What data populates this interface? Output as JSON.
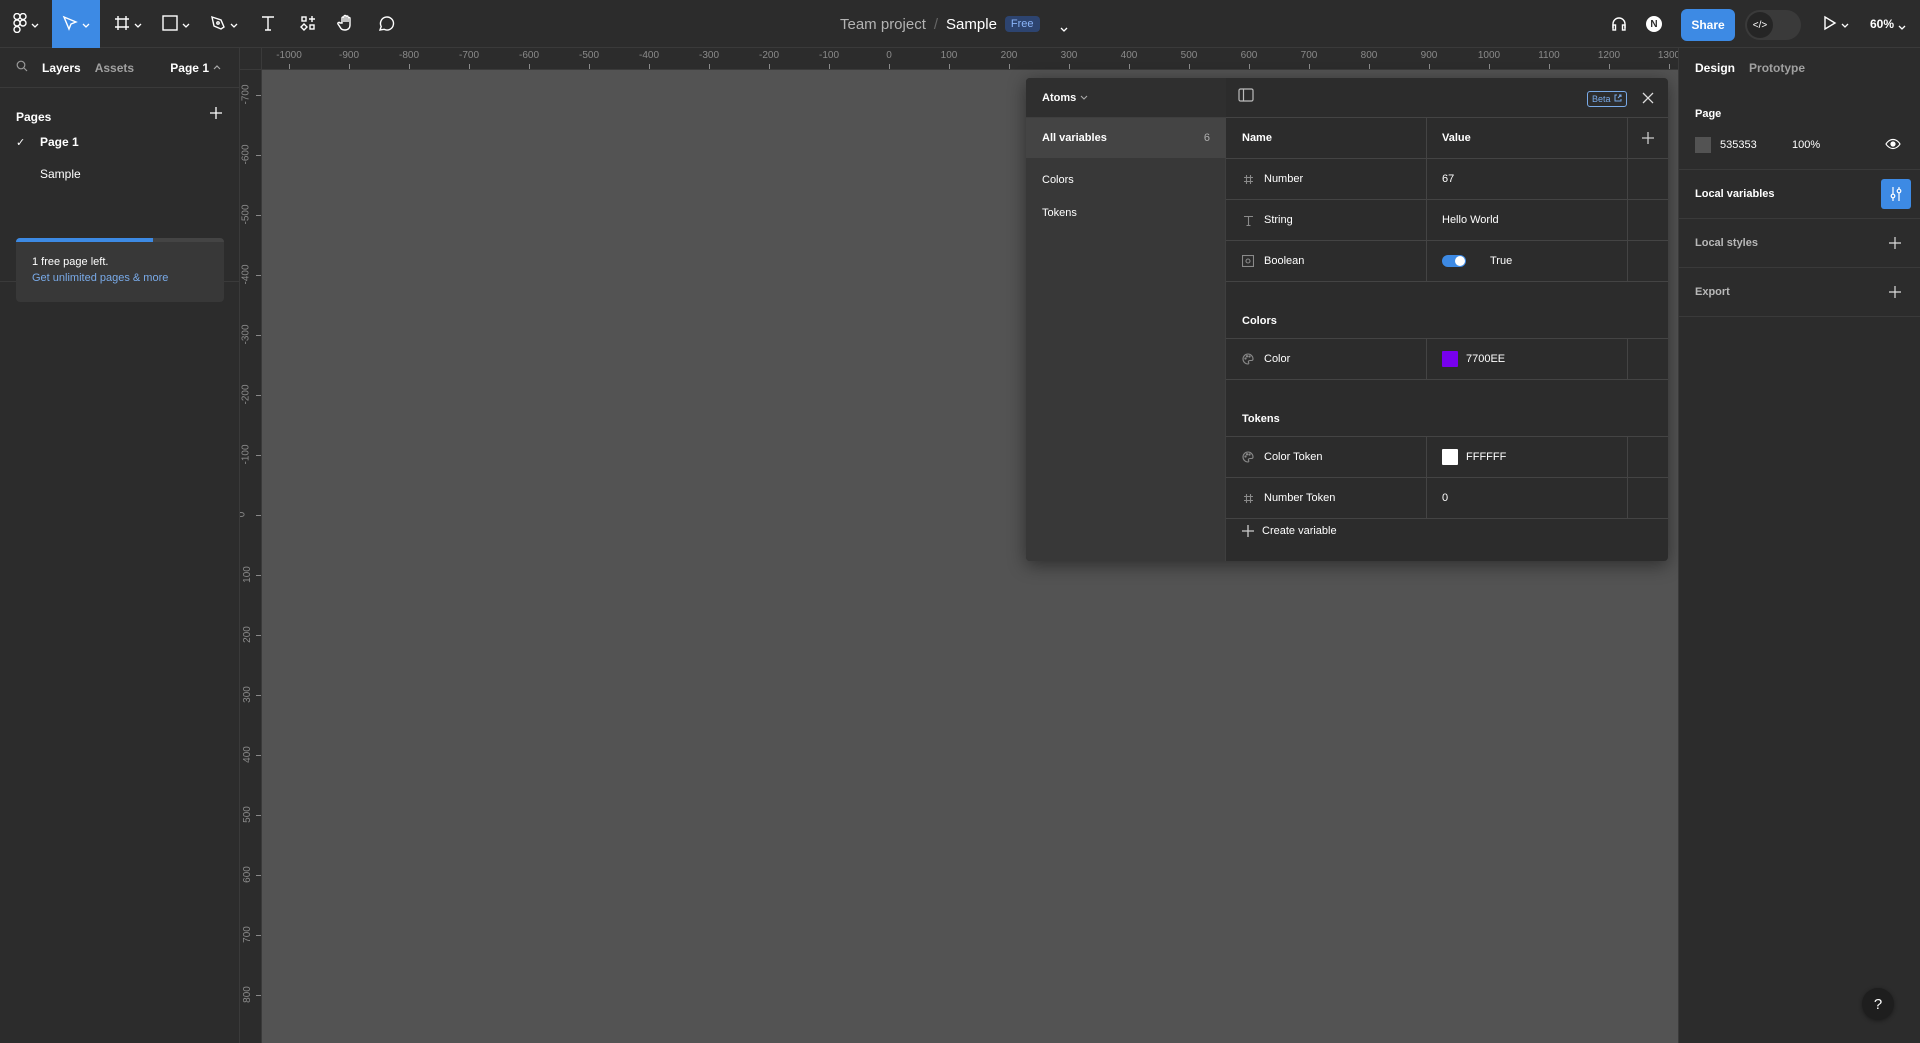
{
  "toolbar": {
    "tools": [
      {
        "name": "main-menu",
        "icon": "figma-logo-icon",
        "has_caret": true
      },
      {
        "name": "move-tool",
        "icon": "cursor-arrow-icon",
        "has_caret": true,
        "active": true
      },
      {
        "name": "frame-tool",
        "icon": "frame-hash-icon",
        "has_caret": true
      },
      {
        "name": "shape-tool",
        "icon": "rectangle-icon",
        "has_caret": true
      },
      {
        "name": "pen-tool",
        "icon": "pen-nib-icon",
        "has_caret": true
      },
      {
        "name": "text-tool",
        "icon": "text-t-icon"
      },
      {
        "name": "resources-tool",
        "icon": "components-icon"
      },
      {
        "name": "hand-tool",
        "icon": "hand-icon"
      },
      {
        "name": "comment-tool",
        "icon": "speech-bubble-icon"
      }
    ],
    "project": "Team project",
    "separator": "/",
    "file_name": "Sample",
    "plan_badge": "Free",
    "share_label": "Share",
    "dev_mode_icon": "</>",
    "zoom": "60%",
    "accent": "#3D8AE4"
  },
  "left_panel": {
    "tabs": [
      "Layers",
      "Assets"
    ],
    "page_selector": "Page 1",
    "pages_title": "Pages",
    "pages": [
      {
        "label": "Page 1",
        "selected": true
      },
      {
        "label": "Sample",
        "selected": false
      }
    ],
    "upgrade": {
      "progress": 0.66,
      "text": "1 free page left.",
      "link": "Get unlimited pages & more"
    }
  },
  "rulers": {
    "horizontal": [
      "-1000",
      "-900",
      "-800",
      "-700",
      "-600",
      "-500",
      "-400",
      "-300",
      "-200",
      "-100",
      "0",
      "100",
      "200",
      "300",
      "400",
      "500",
      "600",
      "700",
      "800",
      "900",
      "1000",
      "1100",
      "1200",
      "1300"
    ],
    "vertical": [
      "-700",
      "-600",
      "-500",
      "-400",
      "-300",
      "-200",
      "-100",
      "0",
      "100",
      "200",
      "300",
      "400",
      "500",
      "600",
      "700",
      "800"
    ]
  },
  "variables_panel": {
    "collection": "Atoms",
    "groups": [
      {
        "label": "All variables",
        "count": "6",
        "selected": true
      },
      {
        "label": "Colors"
      },
      {
        "label": "Tokens"
      }
    ],
    "beta_label": "Beta",
    "columns": {
      "name": "Name",
      "value": "Value"
    },
    "rows_ungrouped": [
      {
        "type_icon": "number-hash-icon",
        "name": "Number",
        "value": "67"
      },
      {
        "type_icon": "string-text-icon",
        "name": "String",
        "value": "Hello World"
      },
      {
        "type_icon": "boolean-icon",
        "name": "Boolean",
        "value": "True",
        "toggle_on": true
      }
    ],
    "sections": [
      {
        "title": "Colors",
        "rows": [
          {
            "type_icon": "color-palette-icon",
            "name": "Color",
            "value": "7700EE",
            "swatch": "#7700EE"
          }
        ]
      },
      {
        "title": "Tokens",
        "rows": [
          {
            "type_icon": "color-palette-icon",
            "name": "Color Token",
            "value": "FFFFFF",
            "swatch": "#FFFFFF"
          },
          {
            "type_icon": "number-hash-icon",
            "name": "Number Token",
            "value": "0"
          }
        ]
      }
    ],
    "create_label": "Create variable"
  },
  "right_panel": {
    "tabs": [
      "Design",
      "Prototype"
    ],
    "page_title": "Page",
    "page_color": "535353",
    "page_color_hex": "#535353",
    "page_opacity": "100%",
    "local_variables": "Local variables",
    "local_styles": "Local styles",
    "export": "Export"
  },
  "help_label": "?"
}
